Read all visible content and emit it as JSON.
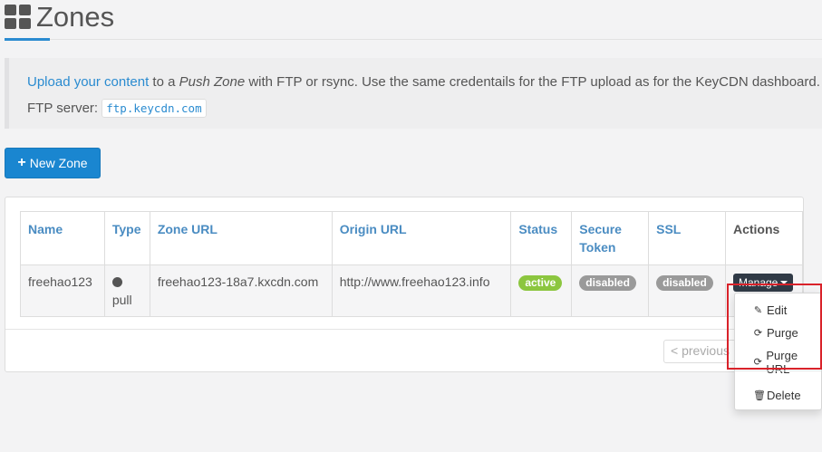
{
  "page": {
    "title": "Zones",
    "title_icon": "th-large-icon"
  },
  "info": {
    "link_text": "Upload your content",
    "text_1": " to a ",
    "push_zone": "Push Zone",
    "text_2": " with FTP or rsync. Use the same credentails for the FTP upload as for the KeyCDN dashboard. FTP server: ",
    "ftp_server": "ftp.keycdn.com"
  },
  "new_zone_button": {
    "icon": "plus-icon",
    "label": "New Zone"
  },
  "table": {
    "headers": {
      "name": "Name",
      "type": "Type",
      "zone_url": "Zone URL",
      "origin_url": "Origin URL",
      "status": "Status",
      "secure_token": "Secure Token",
      "ssl": "SSL",
      "actions": "Actions"
    },
    "rows": [
      {
        "name": "freehao123",
        "type": "pull",
        "zone_url": "freehao123-18a7.kxcdn.com",
        "origin_url": "http://www.freehao123.info",
        "status": "active",
        "secure_token": "disabled",
        "ssl": "disabled",
        "action_label": "Manage"
      }
    ]
  },
  "pagination": {
    "prev_label": "< previous"
  },
  "dropdown": {
    "items": [
      {
        "icon": "pencil-icon",
        "label": "Edit"
      },
      {
        "icon": "refresh-icon",
        "label": "Purge"
      },
      {
        "icon": "refresh-icon",
        "label": "Purge URL"
      },
      {
        "icon": "trash-icon",
        "label": "Delete"
      }
    ]
  },
  "colors": {
    "accent": "#1a86d0",
    "status_active": "#8cc63f",
    "status_disabled": "#9a9a9a",
    "highlight_box": "#d9222a"
  }
}
